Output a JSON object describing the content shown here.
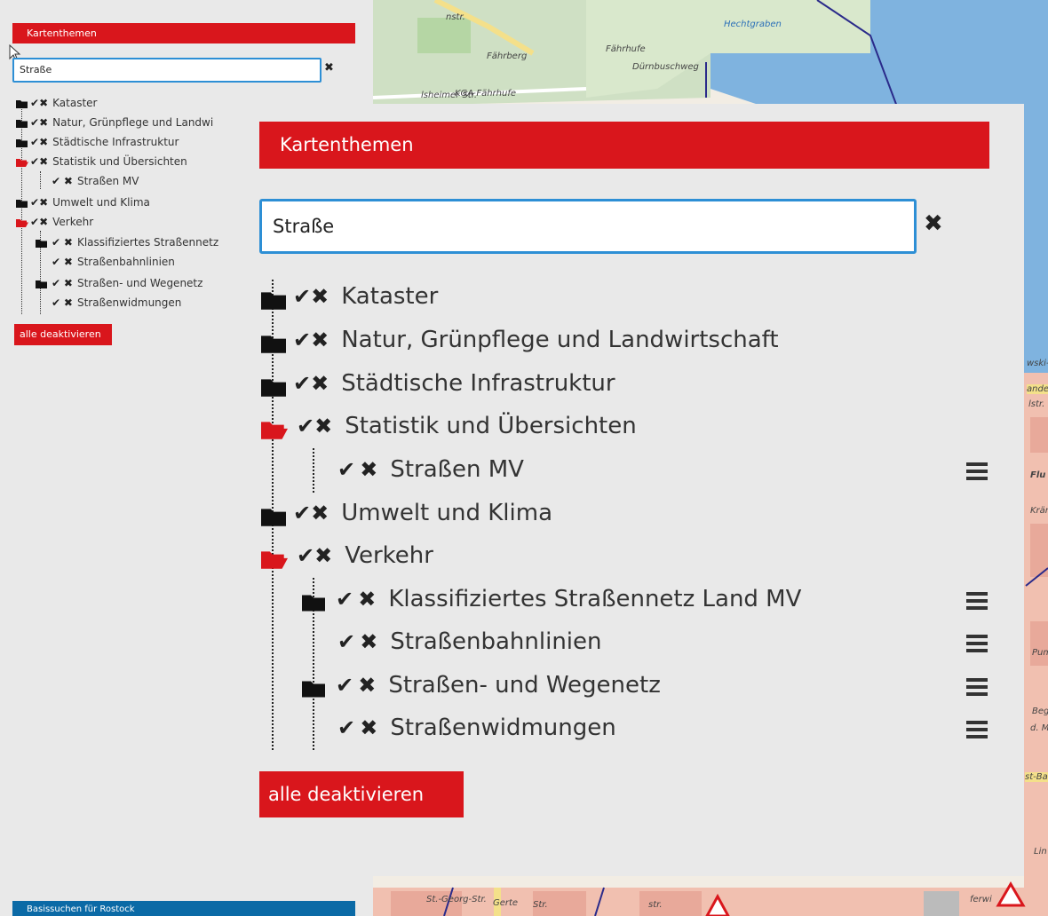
{
  "colors": {
    "accent": "#d9161c",
    "blue": "#0b6aa6",
    "focus": "#2d8fd5"
  },
  "map": {
    "labels": [
      "Hechtgraben",
      "KGA Fährhufe",
      "Fährberg",
      "Fährhufe",
      "Dürnbuschweg",
      "nstr.",
      "lsheimer Str.",
      "wski-",
      "ande",
      "lstr.",
      "Flu",
      "Kräm",
      "Pumpel",
      "Beg",
      "d. M",
      "st-Ba",
      "Lin",
      "St.-Georg-Str.",
      "Gerte",
      "Str.",
      "str.",
      "ferwi"
    ]
  },
  "side": {
    "header": "Kartenthemen",
    "search_value": "Straße",
    "clear_icon": "close-icon",
    "items": [
      {
        "label": "Kataster",
        "type": "folder-closed"
      },
      {
        "label": "Natur, Grünpflege und Landwi",
        "type": "folder-closed"
      },
      {
        "label": "Städtische Infrastruktur",
        "type": "folder-closed"
      },
      {
        "label": "Statistik und Übersichten",
        "type": "folder-open"
      },
      {
        "label": "Straßen MV",
        "type": "layer"
      },
      {
        "label": "Umwelt und Klima",
        "type": "folder-closed"
      },
      {
        "label": "Verkehr",
        "type": "folder-open"
      },
      {
        "label": "Klassifiziertes Straßennetz",
        "type": "folder-closed"
      },
      {
        "label": "Straßenbahnlinien",
        "type": "layer"
      },
      {
        "label": "Straßen- und Wegenetz",
        "type": "folder-closed"
      },
      {
        "label": "Straßenwidmungen",
        "type": "layer"
      }
    ],
    "button": "alle deaktivieren",
    "bottom_header": "Basissuchen für Rostock"
  },
  "zoom": {
    "header": "Kartenthemen",
    "search_value": "Straße",
    "items": [
      {
        "label": "Kataster",
        "type": "folder-closed"
      },
      {
        "label": "Natur, Grünpflege und Landwirtschaft",
        "type": "folder-closed"
      },
      {
        "label": "Städtische Infrastruktur",
        "type": "folder-closed"
      },
      {
        "label": "Statistik und Übersichten",
        "type": "folder-open"
      },
      {
        "label": "Straßen MV",
        "type": "layer"
      },
      {
        "label": "Umwelt und Klima",
        "type": "folder-closed"
      },
      {
        "label": "Verkehr",
        "type": "folder-open"
      },
      {
        "label": "Klassifiziertes Straßennetz Land MV",
        "type": "folder-closed"
      },
      {
        "label": "Straßenbahnlinien",
        "type": "layer"
      },
      {
        "label": "Straßen- und Wegenetz",
        "type": "folder-closed"
      },
      {
        "label": "Straßenwidmungen",
        "type": "layer"
      }
    ],
    "check_glyph": "✔",
    "cross_glyph": "✖",
    "button": "alle deaktivieren"
  }
}
